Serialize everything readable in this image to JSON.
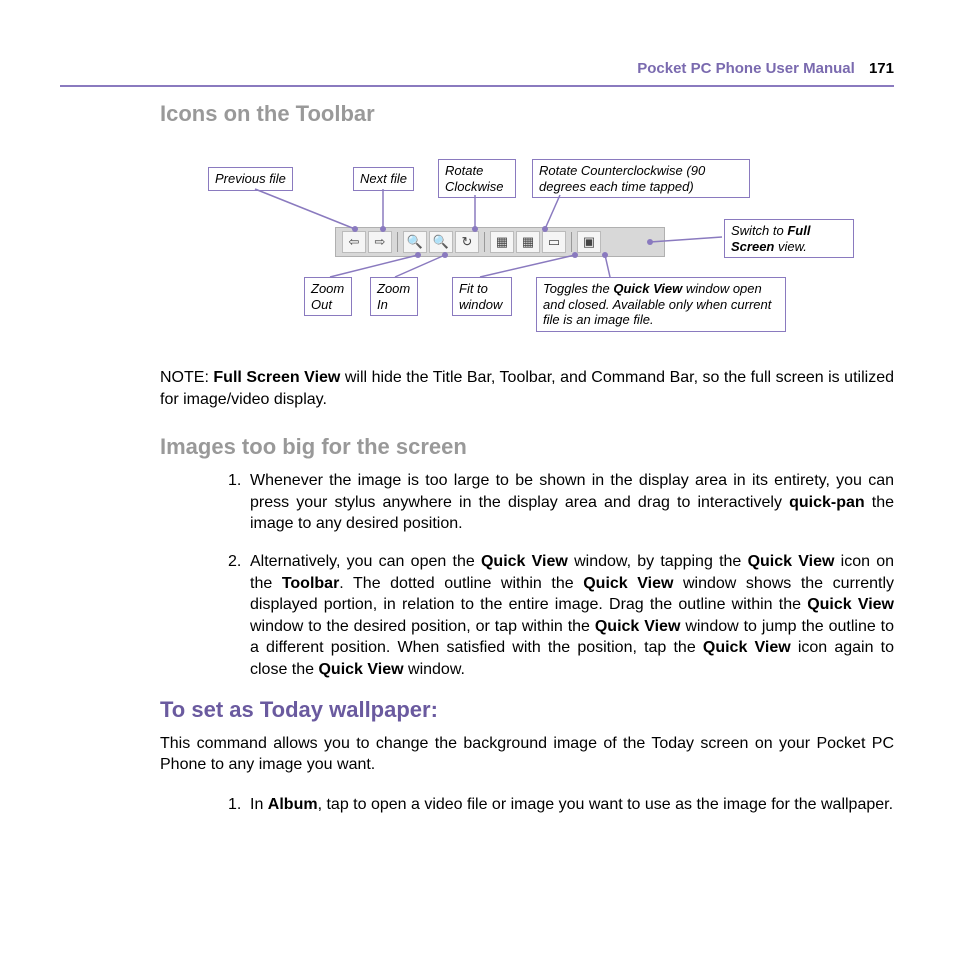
{
  "header": {
    "title": "Pocket PC Phone User Manual",
    "page": "171"
  },
  "sections": {
    "icons_title": "Icons on the Toolbar",
    "images_title": "Images too big for the screen",
    "wallpaper_title": "To set as Today wallpaper:"
  },
  "callouts": {
    "prev_file": "Previous file",
    "next_file": "Next file",
    "rotate_cw": "Rotate Clockwise",
    "rotate_ccw": "Rotate Counterclockwise (90 degrees each time tapped)",
    "zoom_out": "Zoom Out",
    "zoom_in": "Zoom In",
    "fit_window": "Fit to window",
    "quick_view_pre": "Toggles the ",
    "quick_view_bold": "Quick View",
    "quick_view_post": " window open and closed. Available only when current file is an image file.",
    "full_screen_pre": "Switch to ",
    "full_screen_bold": "Full Screen",
    "full_screen_post": " view."
  },
  "note": {
    "prefix": "NOTE: ",
    "bold": "Full Screen View",
    "rest": " will hide the Title Bar, Toolbar, and Command Bar, so the full screen is utilized for image/video display."
  },
  "images_list": {
    "item1_pre": "Whenever the image is too large to be shown in the display area in its entirety, you can press your stylus anywhere in the display area and drag to interactively ",
    "item1_bold": "quick-pan",
    "item1_post": " the image to any desired position.",
    "item2_p1": "Alternatively, you can open the ",
    "item2_b1": "Quick View",
    "item2_p2": " window, by tapping the ",
    "item2_b2": "Quick View",
    "item2_p3": " icon on the ",
    "item2_b3": "Toolbar",
    "item2_p4": ". The dotted outline within the ",
    "item2_b4": "Quick View",
    "item2_p5": " window shows the currently displayed portion, in relation to the entire image. Drag the outline within the ",
    "item2_b5": "Quick View",
    "item2_p6": " window to the desired position, or tap within the ",
    "item2_b6": "Quick View",
    "item2_p7": " window to jump the outline to a different position. When satisfied with the position, tap the ",
    "item2_b7": "Quick View",
    "item2_p8": " icon again to close the ",
    "item2_b8": "Quick View",
    "item2_p9": " window."
  },
  "wallpaper": {
    "intro": "This command allows you to change the background image of the Today screen on your Pocket PC Phone to any image you want.",
    "item1_pre": "In ",
    "item1_bold": "Album",
    "item1_post": ", tap to open a video file or image you want to use as the image for the wallpaper."
  }
}
